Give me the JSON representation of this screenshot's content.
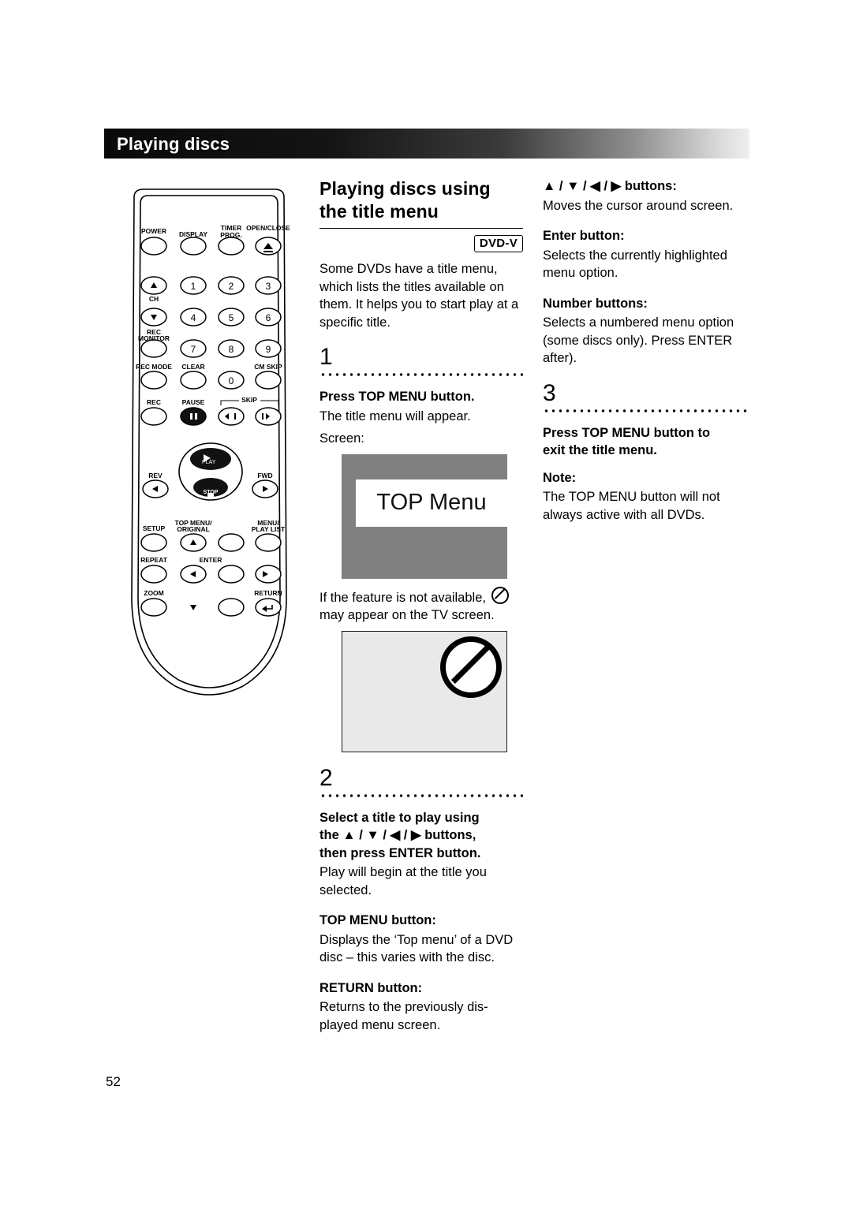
{
  "header": {
    "title": "Playing discs"
  },
  "page": {
    "number": "52"
  },
  "section": {
    "title_line1": "Playing discs using",
    "title_line2": "the title menu",
    "badge": "DVD-V",
    "intro": "Some DVDs have a title menu, which lists the titles available on them. It helps you to start play at a specific title."
  },
  "steps": {
    "one": {
      "num": "1",
      "heading": "Press TOP MENU button.",
      "body": "The title menu will appear.",
      "screen_label": "Screen:",
      "tv_text": "TOP Menu",
      "note_line1": "If the feature is not available,",
      "note_line2": "may appear on the TV screen."
    },
    "two": {
      "num": "2",
      "heading_line1": "Select a title to play using",
      "heading_line2": "the ▲ / ▼ / ◀ / ▶ buttons,",
      "heading_line3": "then press ENTER button.",
      "body": "Play will begin at the title you selected.",
      "topmenu_head": "TOP MENU button:",
      "topmenu_body": "Displays the ‘Top menu’ of a DVD disc – this varies with the disc.",
      "return_head": "RETURN button:",
      "return_body": "Returns to the previously dis-played menu screen."
    },
    "three": {
      "num": "3",
      "heading_line1": "Press TOP MENU button to",
      "heading_line2": "exit the title menu.",
      "note_head": "Note:",
      "note_body": "The TOP MENU button will not always active with all DVDs."
    }
  },
  "right_column": {
    "cursor_head": "▲ / ▼ / ◀ / ▶ buttons:",
    "cursor_body": "Moves the cursor around screen.",
    "enter_head": "Enter button:",
    "enter_body": "Selects the currently highlighted menu option.",
    "number_head": "Number buttons:",
    "number_body": "Selects a numbered menu option (some discs only). Press ENTER after)."
  },
  "remote": {
    "labels": {
      "power": "POWER",
      "display": "DISPLAY",
      "timer_prog_1": "TIMER",
      "timer_prog_2": "PROG.",
      "open_close": "OPEN/CLOSE",
      "ch": "CH",
      "rec_monitor_1": "REC",
      "rec_monitor_2": "MONITOR",
      "rec_mode": "REC MODE",
      "clear": "CLEAR",
      "cm_skip": "CM SKIP",
      "rec": "REC",
      "pause": "PAUSE",
      "skip": "SKIP",
      "rev": "REV",
      "play": "PLAY",
      "fwd": "FWD",
      "stop": "STOP",
      "setup": "SETUP",
      "top_menu_1": "TOP MENU/",
      "top_menu_2": "ORIGINAL",
      "menu_1": "MENU/",
      "menu_2": "PLAY LIST",
      "repeat": "REPEAT",
      "enter": "ENTER",
      "zoom": "ZOOM",
      "return": "RETURN"
    },
    "keys": {
      "one": "1",
      "two": "2",
      "three": "3",
      "four": "4",
      "five": "5",
      "six": "6",
      "seven": "7",
      "eight": "8",
      "nine": "9",
      "zero": "0"
    }
  }
}
